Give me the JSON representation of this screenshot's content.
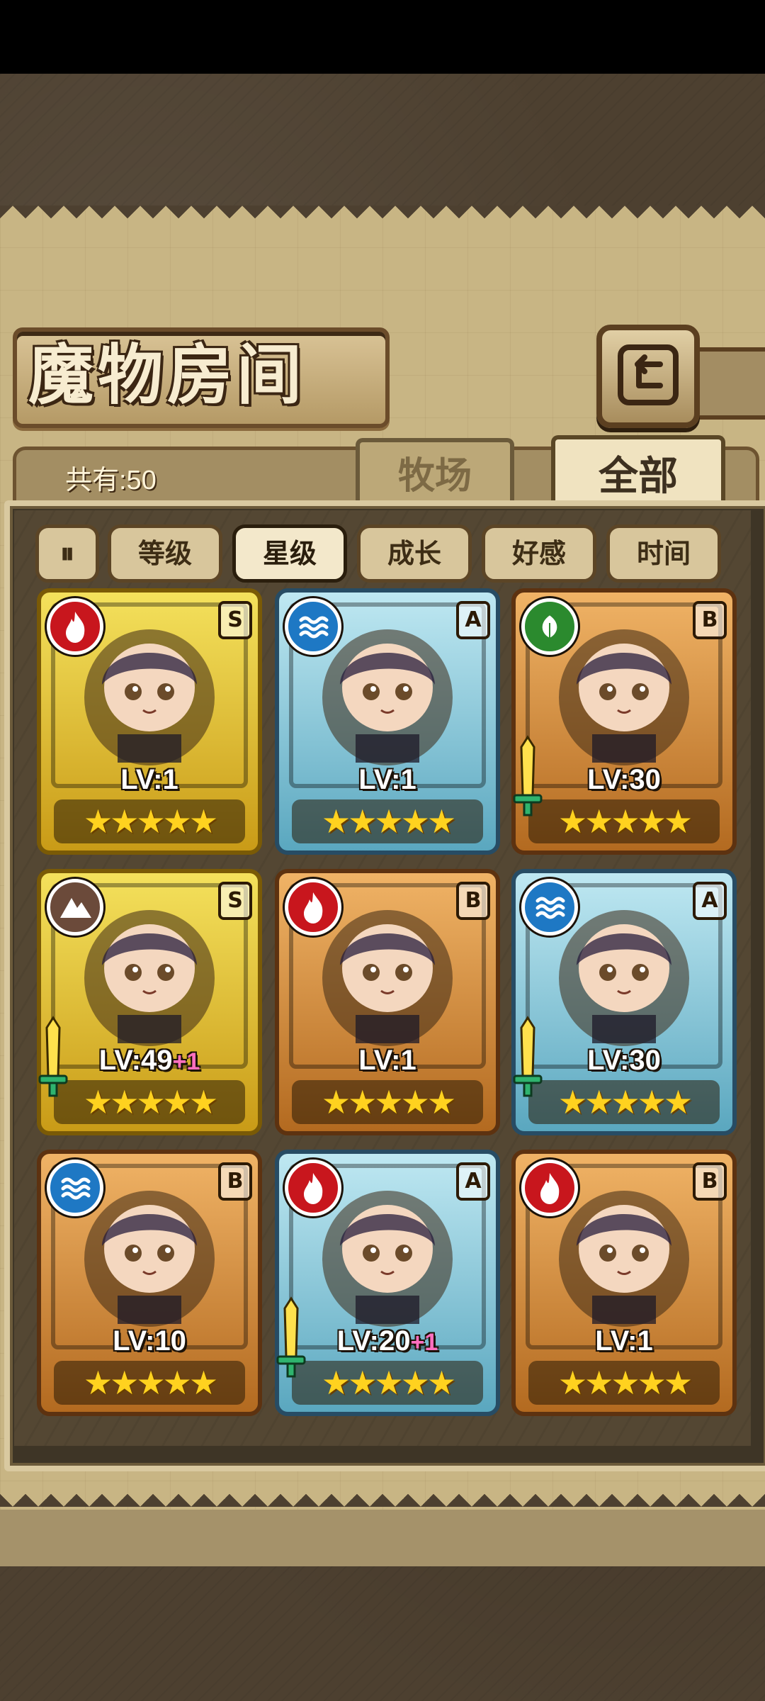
{
  "header": {
    "title": "魔物房间"
  },
  "tabs": [
    {
      "label": "牧场",
      "active": false
    },
    {
      "label": "全部",
      "active": true
    }
  ],
  "summary": {
    "count_label": "共有:50"
  },
  "filters": {
    "toggle_label": "⏸",
    "items": [
      {
        "label": "等级",
        "active": false
      },
      {
        "label": "星级",
        "active": true
      },
      {
        "label": "成长",
        "active": false
      },
      {
        "label": "好感",
        "active": false
      },
      {
        "label": "时间",
        "active": false
      }
    ]
  },
  "monsters": [
    {
      "element": "fire",
      "rank": "S",
      "frame": "gold",
      "level": "LV:1",
      "bonus": "",
      "stars": "★★★★★",
      "equip": false
    },
    {
      "element": "water",
      "rank": "A",
      "frame": "blue",
      "level": "LV:1",
      "bonus": "",
      "stars": "★★★★★",
      "equip": false
    },
    {
      "element": "nature",
      "rank": "B",
      "frame": "bronze",
      "level": "LV:30",
      "bonus": "",
      "stars": "★★★★★",
      "equip": true
    },
    {
      "element": "earth",
      "rank": "S",
      "frame": "gold",
      "level": "LV:49",
      "bonus": "+1",
      "stars": "★★★★★",
      "equip": true
    },
    {
      "element": "fire",
      "rank": "B",
      "frame": "bronze",
      "level": "LV:1",
      "bonus": "",
      "stars": "★★★★★",
      "equip": false
    },
    {
      "element": "water",
      "rank": "A",
      "frame": "blue",
      "level": "LV:30",
      "bonus": "",
      "stars": "★★★★★",
      "equip": true
    },
    {
      "element": "water",
      "rank": "B",
      "frame": "bronze",
      "level": "LV:10",
      "bonus": "",
      "stars": "★★★★★",
      "equip": false
    },
    {
      "element": "fire",
      "rank": "A",
      "frame": "blue",
      "level": "LV:20",
      "bonus": "+1",
      "stars": "★★★★★",
      "equip": true
    },
    {
      "element": "fire",
      "rank": "B",
      "frame": "bronze",
      "level": "LV:1",
      "bonus": "",
      "stars": "★★★★★",
      "equip": false
    }
  ],
  "colors": {
    "gold_frame": "#f4e15c",
    "blue_frame": "#5aa7bf",
    "bronze_frame": "#f0b366",
    "fire": "#c8161d",
    "water": "#1e78c4",
    "nature": "#2b8a2e",
    "earth": "#6b4a3a",
    "bonus": "#ff6fbf"
  }
}
